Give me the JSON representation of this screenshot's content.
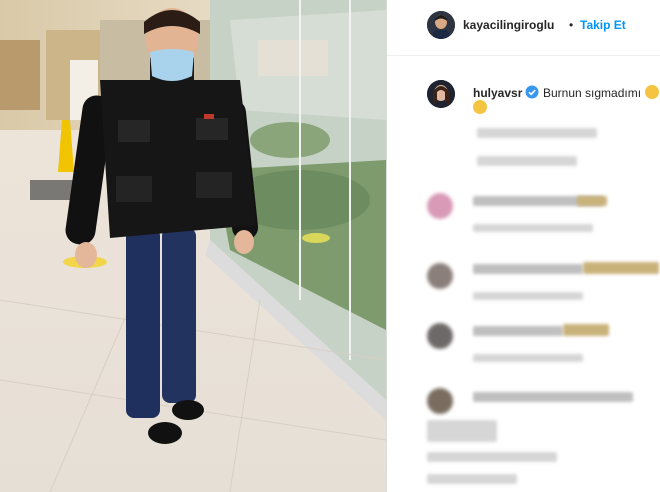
{
  "post_photo": {
    "description": "Man in black vest, face mask and jeans walking in a shopping mall"
  },
  "header": {
    "username": "kayacilingiroglu",
    "separator": "•",
    "follow_label": "Takip Et"
  },
  "caption": {
    "username": "hulyavsr",
    "text": "Burnun sıgmadımı",
    "verified": true
  },
  "comments": [
    {
      "blurred": true
    },
    {
      "blurred": true
    },
    {
      "blurred": true
    },
    {
      "blurred": true
    },
    {
      "blurred": true
    },
    {
      "blurred": true
    }
  ],
  "colors": {
    "follow": "#0095f6",
    "verified": "#3897f0",
    "text": "#262626"
  }
}
